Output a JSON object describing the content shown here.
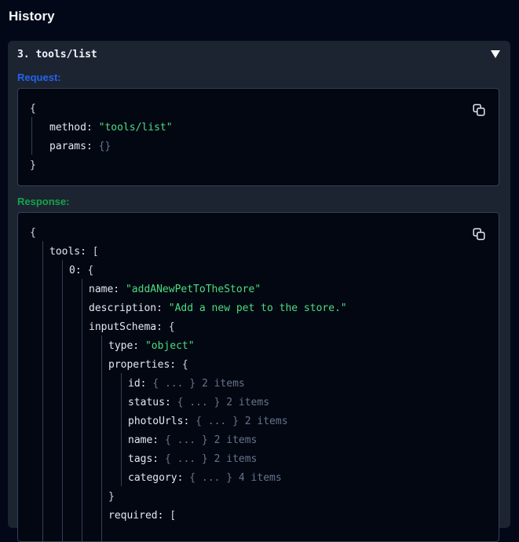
{
  "history": {
    "title": "History"
  },
  "entry": {
    "label": "3. tools/list"
  },
  "request": {
    "label": "Request:",
    "open": "{",
    "close": "}",
    "method_key": "method:",
    "method_value": "\"tools/list\"",
    "params_key": "params:",
    "params_value": "{}"
  },
  "response": {
    "label": "Response:",
    "open": "{",
    "tools_key": "tools:",
    "tools_open": "[",
    "item0_key": "0:",
    "item0_open": "{",
    "name_key": "name:",
    "name_value": "\"addANewPetToTheStore\"",
    "description_key": "description:",
    "description_value": "\"Add a new pet to the store.\"",
    "inputSchema_key": "inputSchema:",
    "inputSchema_open": "{",
    "type_key": "type:",
    "type_value": "\"object\"",
    "properties_key": "properties:",
    "properties_open": "{",
    "properties": [
      {
        "key": "id:",
        "collapsed": "{ ... }",
        "count": "2 items"
      },
      {
        "key": "status:",
        "collapsed": "{ ... }",
        "count": "2 items"
      },
      {
        "key": "photoUrls:",
        "collapsed": "{ ... }",
        "count": "2 items"
      },
      {
        "key": "name:",
        "collapsed": "{ ... }",
        "count": "2 items"
      },
      {
        "key": "tags:",
        "collapsed": "{ ... }",
        "count": "2 items"
      },
      {
        "key": "category:",
        "collapsed": "{ ... }",
        "count": "4 items"
      }
    ],
    "properties_close": "}",
    "required_key": "required:",
    "required_open": "["
  },
  "icons": {
    "copy": "copy-icon",
    "toggle": "triangle-down-icon"
  }
}
